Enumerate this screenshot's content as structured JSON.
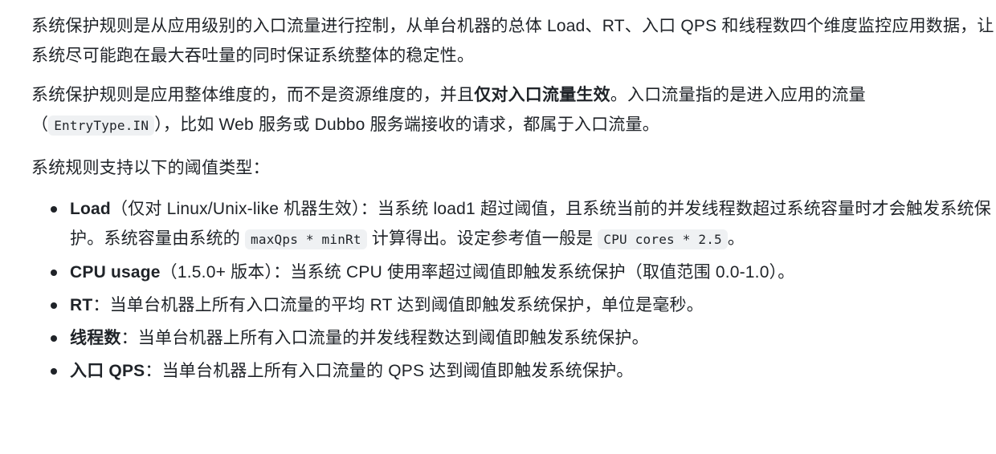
{
  "paragraphs": {
    "p1": "系统保护规则是从应用级别的入口流量进行控制，从单台机器的总体 Load、RT、入口 QPS 和线程数四个维度监控应用数据，让系统尽可能跑在最大吞吐量的同时保证系统整体的稳定性。",
    "p2_a": "系统保护规则是应用整体维度的，而不是资源维度的，并且",
    "p2_strong": "仅对入口流量生效",
    "p2_b": "。入口流量指的是进入应用的流量（",
    "p2_code": "EntryType.IN",
    "p2_c": "），比如 Web 服务或 Dubbo 服务端接收的请求，都属于入口流量。",
    "p3": "系统规则支持以下的阈值类型："
  },
  "list": {
    "load_label": "Load",
    "load_text_a": "（仅对 Linux/Unix-like 机器生效）：当系统 load1 超过阈值，且系统当前的并发线程数超过系统容量时才会触发系统保护。系统容量由系统的 ",
    "load_code1": "maxQps * minRt",
    "load_text_b": " 计算得出。设定参考值一般是 ",
    "load_code2": "CPU cores * 2.5",
    "load_text_c": "。",
    "cpu_label": "CPU usage",
    "cpu_text": "（1.5.0+ 版本）：当系统 CPU 使用率超过阈值即触发系统保护（取值范围 0.0-1.0）。",
    "rt_label": "RT",
    "rt_text": "：当单台机器上所有入口流量的平均 RT 达到阈值即触发系统保护，单位是毫秒。",
    "thread_label": "线程数",
    "thread_text": "：当单台机器上所有入口流量的并发线程数达到阈值即触发系统保护。",
    "qps_label": "入口 QPS",
    "qps_text": "：当单台机器上所有入口流量的 QPS 达到阈值即触发系统保护。"
  }
}
